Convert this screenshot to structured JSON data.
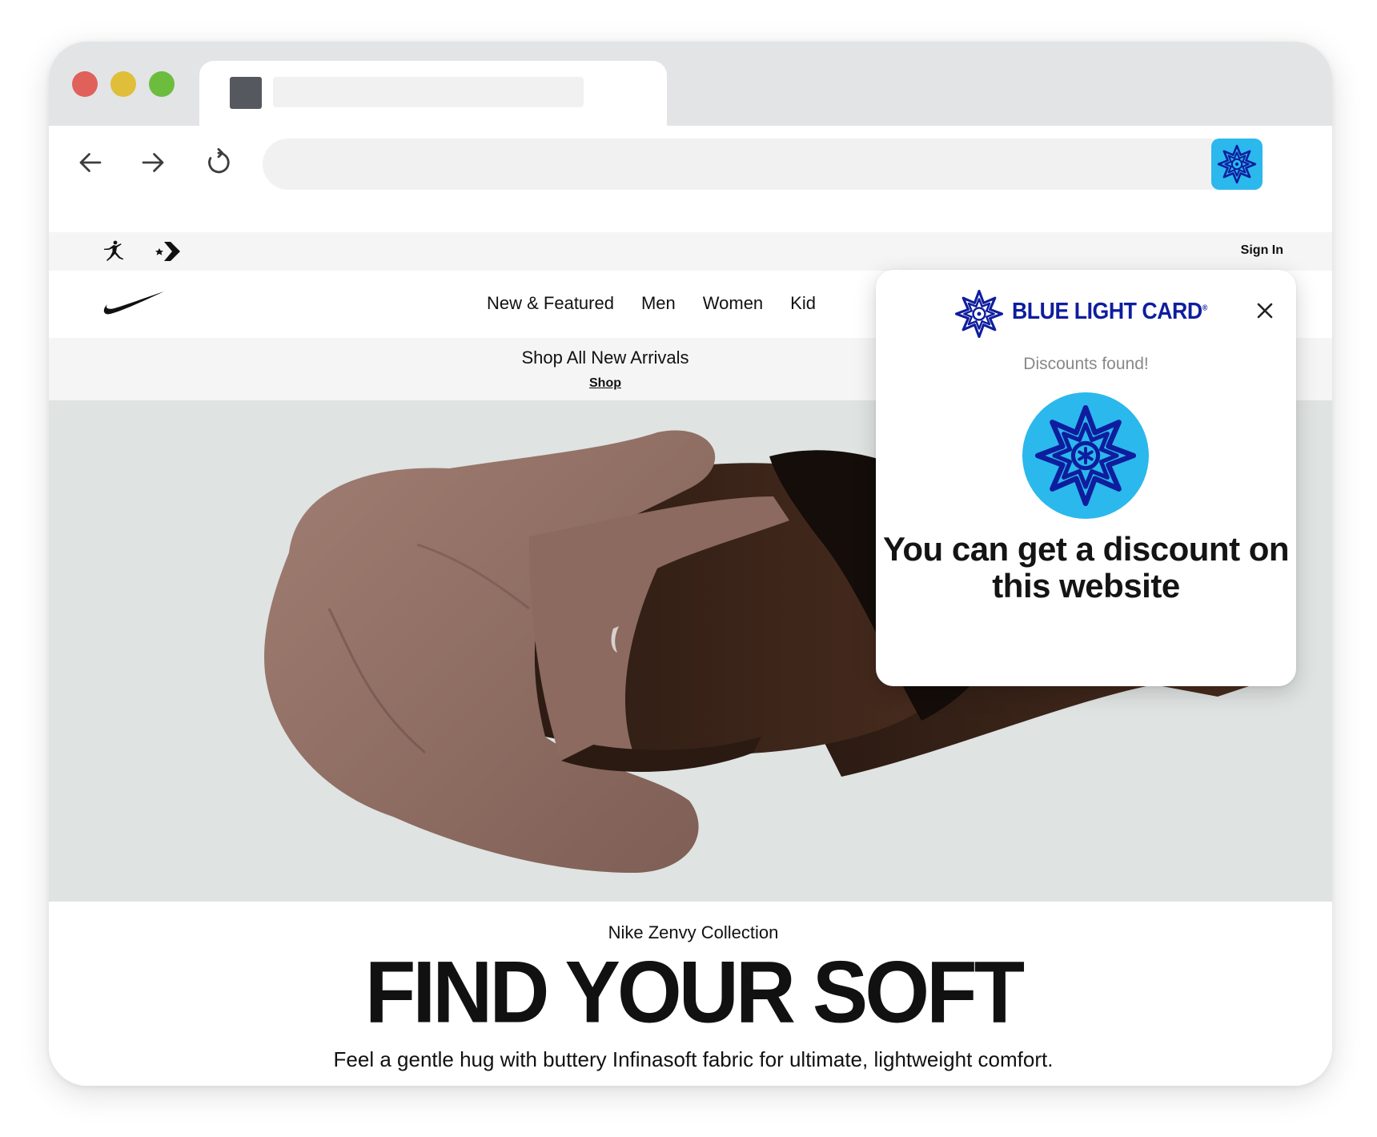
{
  "browser": {
    "address_value": "",
    "address_placeholder": ""
  },
  "nike": {
    "utility": {
      "sign_in": "Sign In"
    },
    "nav": {
      "items": [
        "New & Featured",
        "Men",
        "Women",
        "Kid"
      ]
    },
    "promo": {
      "title": "Shop All New Arrivals",
      "link": "Shop"
    },
    "hero": {
      "eyebrow": "Nike Zenvy Collection",
      "headline": "FIND YOUR SOFT",
      "subline": "Feel a gentle hug with buttery Infinasoft fabric for ultimate, lightweight comfort."
    }
  },
  "extension": {
    "brand": "BLUE LIGHT CARD",
    "brand_mark": "®",
    "status": "Discounts found!",
    "message": "You can get a discount on this website",
    "icon": "blue-light-card-star-icon"
  },
  "colors": {
    "extension_blue": "#2bb8ec",
    "brand_navy": "#0e1d9e",
    "tab_strip": "#e3e4e6",
    "hero_bg": "#dfe3e2"
  }
}
